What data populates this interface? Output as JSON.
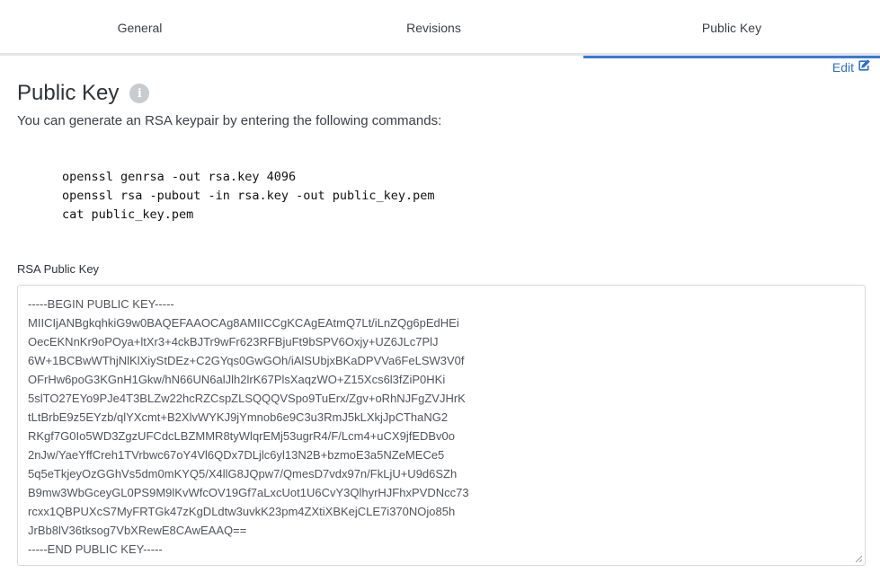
{
  "tabs": [
    {
      "label": "General"
    },
    {
      "label": "Revisions"
    },
    {
      "label": "Public Key"
    }
  ],
  "active_tab": "Public Key",
  "accent_color": "#3a7bd5",
  "edit": {
    "label": "Edit",
    "icon": "edit-icon"
  },
  "page": {
    "title": "Public Key",
    "info_icon": "info-icon",
    "description": "You can generate an RSA keypair by entering the following commands:"
  },
  "commands": [
    "openssl genrsa -out rsa.key 4096",
    "openssl rsa -pubout -in rsa.key -out public_key.pem",
    "cat public_key.pem"
  ],
  "public_key": {
    "label": "RSA Public Key",
    "lines": [
      "-----BEGIN PUBLIC KEY-----",
      "MIICIjANBgkqhkiG9w0BAQEFAAOCAg8AMIICCgKCAgEAtmQ7Lt/iLnZQg6pEdHEi",
      "OecEKNnKr9oPOya+ltXr3+4ckBJTr9wFr623RFBjuFt9bSPV6Oxjy+UZ6JLc7PlJ",
      "6W+1BCBwWThjNlKlXiyStDEz+C2GYqs0GwGOh/iAlSUbjxBKaDPVVa6FeLSW3V0f",
      "OFrHw6poG3KGnH1Gkw/hN66UN6alJlh2lrK67PlsXaqzWO+Z15Xcs6l3fZiP0HKi",
      "5slTO27EYo9PJe4T3BLZw22hcRZCspZLSQQQVSpo9TuErx/Zgv+oRhNJFgZVJHrK",
      "tLtBrbE9z5EYzb/qlYXcmt+B2XlvWYKJ9jYmnob6e9C3u3RmJ5kLXkjJpCThaNG2",
      "RKgf7G0Io5WD3ZgzUFCdcLBZMMR8tyWlqrEMj53ugrR4/F/Lcm4+uCX9jfEDBv0o",
      "2nJw/YaeYffCreh1TVrbwc67oY4Vl6QDx7DLjlc6yl13N2B+bzmoE3a5NZeMECe5",
      "5q5eTkjeyOzGGhVs5dm0mKYQ5/X4llG8JQpw7/QmesD7vdx97n/FkLjU+U9d6SZh",
      "B9mw3WbGceyGL0PS9M9lKvWfcOV19Gf7aLxcUot1U6CvY3QlhyrHJFhxPVDNcc73",
      "rcxx1QBPUXcS7MyFRTGk47zKgDLdtw3uvkK23pm4ZXtiXBKejCLE7i370NOjo85h",
      "JrBb8lV36tksog7VbXRewE8CAwEAAQ==",
      "-----END PUBLIC KEY-----"
    ]
  }
}
